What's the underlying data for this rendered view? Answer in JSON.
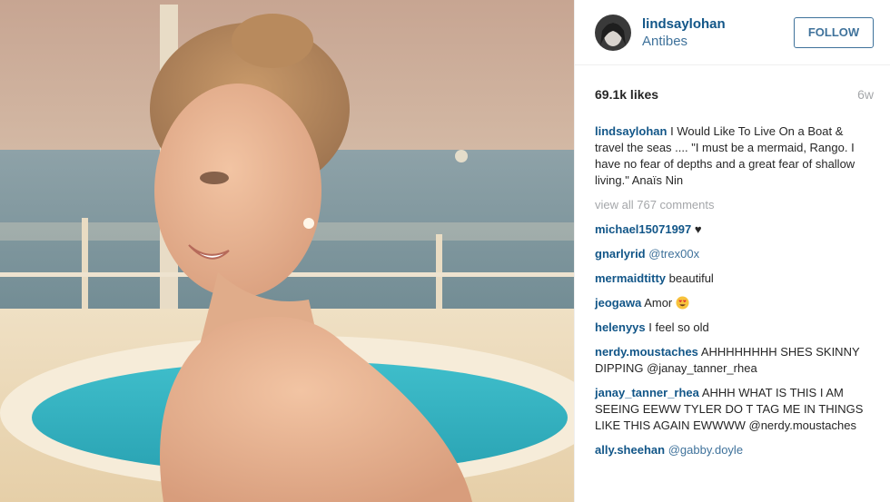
{
  "post": {
    "username": "lindsaylohan",
    "location": "Antibes",
    "follow_label": "FOLLOW",
    "likes": "69.1k likes",
    "age": "6w",
    "caption": "I Would Like To Live On a Boat & travel the seas .... \"I must be a mermaid, Rango. I have no fear of depths and a great fear of shallow living.\" Anaïs Nin",
    "view_all": "view all 767 comments"
  },
  "comments": [
    {
      "user": "michael15071997",
      "text": "♥"
    },
    {
      "user": "gnarlyrid",
      "text": "@trex00x"
    },
    {
      "user": "mermaidtitty",
      "text": "beautiful"
    },
    {
      "user": "jeogawa",
      "text": "Amor",
      "emoji": "heart-eyes-emoji"
    },
    {
      "user": "helenyys",
      "text": "I feel so old"
    },
    {
      "user": "nerdy.moustaches",
      "text": "AHHHHHHHH SHES SKINNY DIPPING @janay_tanner_rhea"
    },
    {
      "user": "janay_tanner_rhea",
      "text": "AHHH WHAT IS THIS I AM SEEING EEWW TYLER DO T TAG ME IN THINGS LIKE THIS AGAIN EWWWW @nerdy.moustaches"
    },
    {
      "user": "ally.sheehan",
      "text": "@gabby.doyle"
    }
  ],
  "colors": {
    "username": "#125688",
    "link": "#3f729b",
    "muted": "#a5a7aa"
  }
}
